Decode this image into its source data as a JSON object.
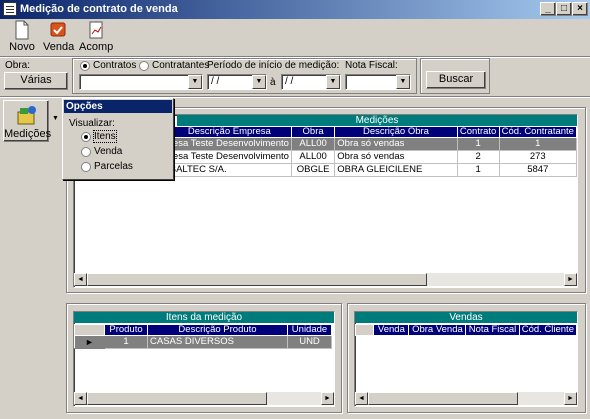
{
  "window": {
    "title": "Medição de contrato de venda",
    "minimize": "_",
    "maximize": "□",
    "close": "×"
  },
  "toolbar": {
    "novo": "Novo",
    "venda": "Venda",
    "acomp": "Acomp"
  },
  "filters": {
    "obra_label": "Obra:",
    "obra_button": "Várias",
    "radio_contratos": "Contratos",
    "radio_contratantes": "Contratantes",
    "periodo_label": "Período de início de medição:",
    "date_from": "/ /",
    "a_label": "à",
    "date_to": "/ /",
    "nota_label": "Nota Fiscal:",
    "buscar": "Buscar"
  },
  "side": {
    "medicoes_button": "Medições",
    "dropdown_arrow": "▼"
  },
  "menu": {
    "title": "Opções",
    "visualizar": "Visualizar:",
    "options": [
      "Itens",
      "Venda",
      "Parcelas"
    ],
    "selected": "Itens"
  },
  "medicoes": {
    "title": "Medições",
    "columns": [
      "Descrição Empresa",
      "Obra",
      "Descrição Obra",
      "Contrato",
      "Cód. Contratante"
    ],
    "rows": [
      [
        "resa Teste Desenvolvimento",
        "ALL00",
        "Obra só vendas",
        "1",
        "1"
      ],
      [
        "resa Teste Desenvolvimento",
        "ALL00",
        "Obra só vendas",
        "2",
        "273"
      ],
      [
        "BALTEC S/A.",
        "OBGLE",
        "OBRA GLEICILENE",
        "1",
        "5847"
      ]
    ]
  },
  "itens": {
    "title": "Itens da medição",
    "columns": [
      "Produto",
      "Descrição Produto",
      "Unidade"
    ],
    "rows": [
      [
        "1",
        "CASAS DIVERSOS",
        "UND"
      ]
    ]
  },
  "vendas": {
    "title": "Vendas",
    "columns": [
      "Venda",
      "Obra Venda",
      "Nota Fiscal",
      "Cód. Cliente"
    ]
  },
  "scroll": {
    "left": "◄",
    "right": "►",
    "indicator": "►"
  }
}
